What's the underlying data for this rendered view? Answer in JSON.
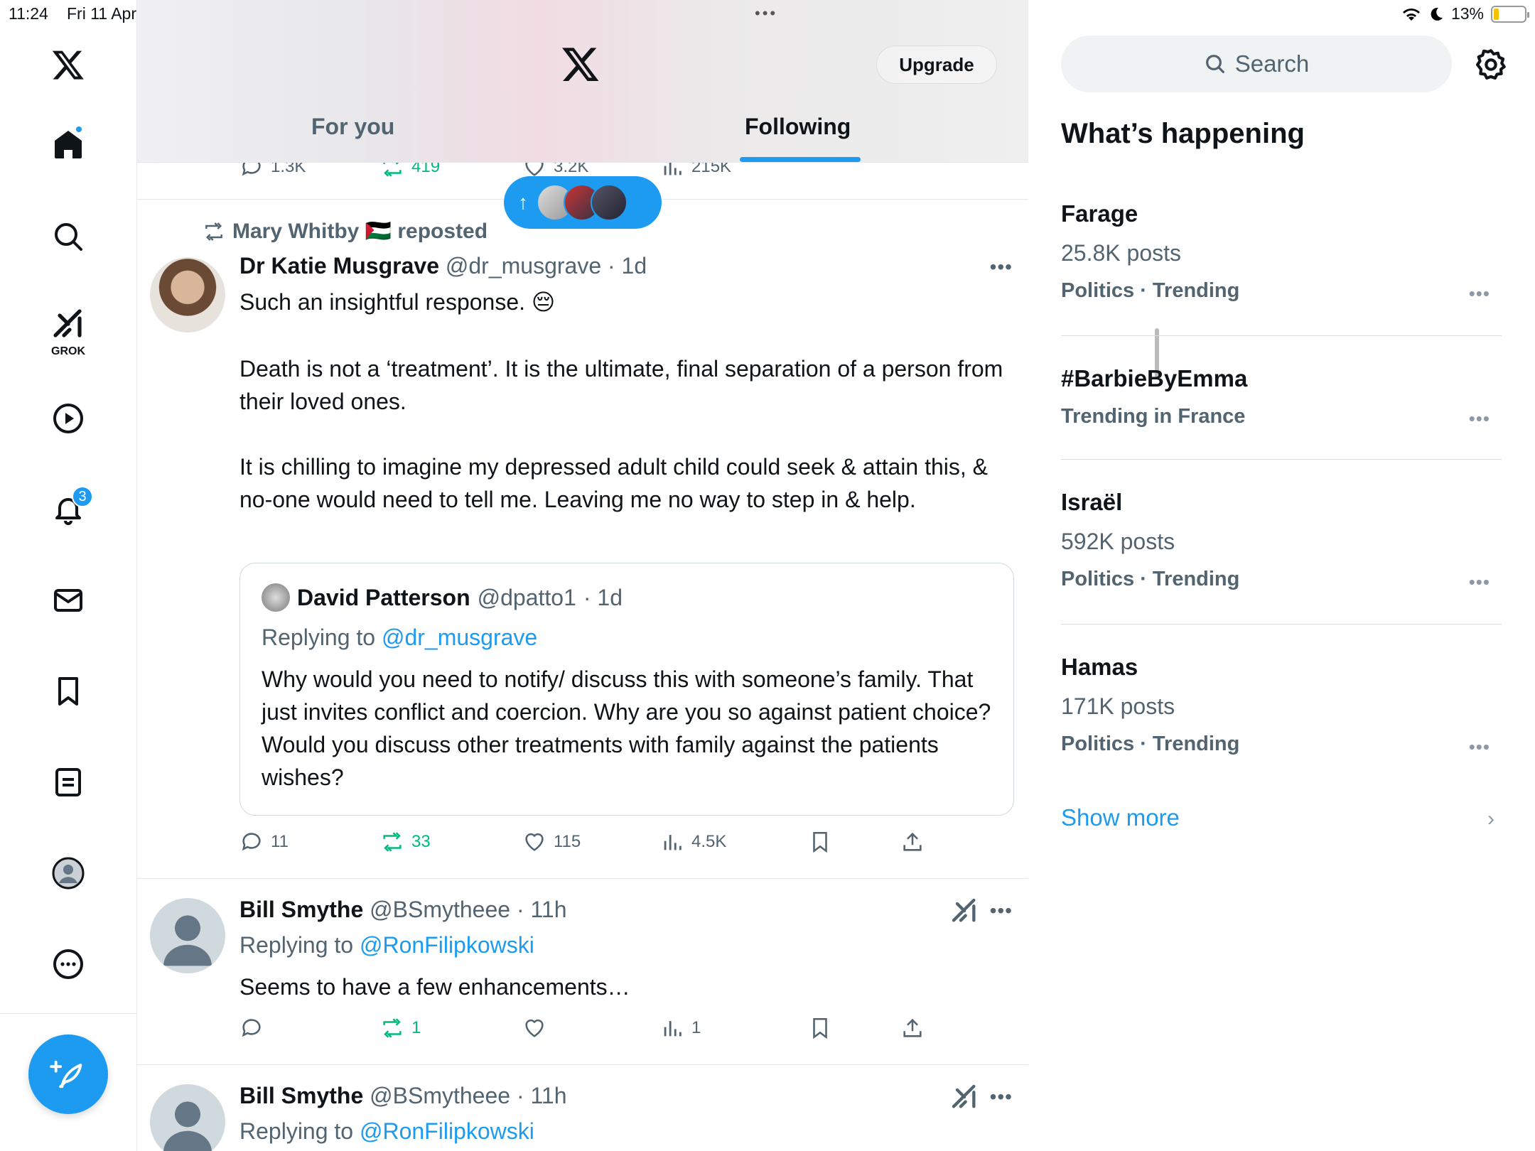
{
  "status": {
    "time": "11:24",
    "date": "Fri 11 Apr",
    "battery": "13%"
  },
  "nav": {
    "grok_label": "GROK",
    "notifications_count": "3"
  },
  "header": {
    "upgrade_label": "Upgrade",
    "tabs": [
      "For you",
      "Following"
    ],
    "active_tab": "Following"
  },
  "prev_tweet_stats": {
    "replies": "1.3K",
    "reposts": "419",
    "likes": "3.2K",
    "views": "215K"
  },
  "tweet1": {
    "repost_by": "Mary Whitby 🇵🇸 reposted",
    "name": "Dr Katie Musgrave",
    "handle": "@dr_musgrave",
    "time": "· 1d",
    "text_p1": "Such an insightful response. 😔",
    "text_p2": "Death is not a ‘treatment’. It is the ultimate, final separation of a person from their loved ones.",
    "text_p3": "It is chilling to imagine my depressed adult child  could seek & attain this, & no-one would need to tell me. Leaving me no way to step in & help.",
    "quote": {
      "name": "David Patterson",
      "handle": "@dpatto1",
      "time": "· 1d",
      "replying_prefix": "Replying to ",
      "replying_to": "@dr_musgrave",
      "text": "Why would you need to notify/ discuss this with someone’s family. That just invites conflict and coercion. Why are you so against patient choice? Would you discuss other treatments with family against the patients wishes?"
    },
    "stats": {
      "replies": "11",
      "reposts": "33",
      "likes": "115",
      "views": "4.5K"
    }
  },
  "tweet2": {
    "name": "Bill Smythe",
    "handle": "@BSmytheee",
    "time": "· 11h",
    "replying_prefix": "Replying to ",
    "replying_to": "@RonFilipkowski",
    "text": "Seems to have a few enhancements…",
    "stats": {
      "replies": "",
      "reposts": "1",
      "likes": "",
      "views": "1"
    }
  },
  "tweet3": {
    "name": "Bill Smythe",
    "handle": "@BSmytheee",
    "time": "· 11h",
    "replying_prefix": "Replying to ",
    "replying_to": "@RonFilipkowski"
  },
  "right": {
    "search_placeholder": "Search",
    "section_title": "What’s happening",
    "trends": [
      {
        "title": "Farage",
        "posts": "25.8K posts",
        "category": "Politics · Trending"
      },
      {
        "title": "#BarbieByEmma",
        "posts": "",
        "category": "Trending in France"
      },
      {
        "title": "Israël",
        "posts": "592K posts",
        "category": "Politics · Trending"
      },
      {
        "title": "Hamas",
        "posts": "171K posts",
        "category": "Politics · Trending"
      }
    ],
    "show_more": "Show more"
  },
  "colors": {
    "accent": "#1d9bf0",
    "repost_green": "#00ba7c",
    "text_primary": "#0f1419",
    "text_secondary": "#536471"
  }
}
